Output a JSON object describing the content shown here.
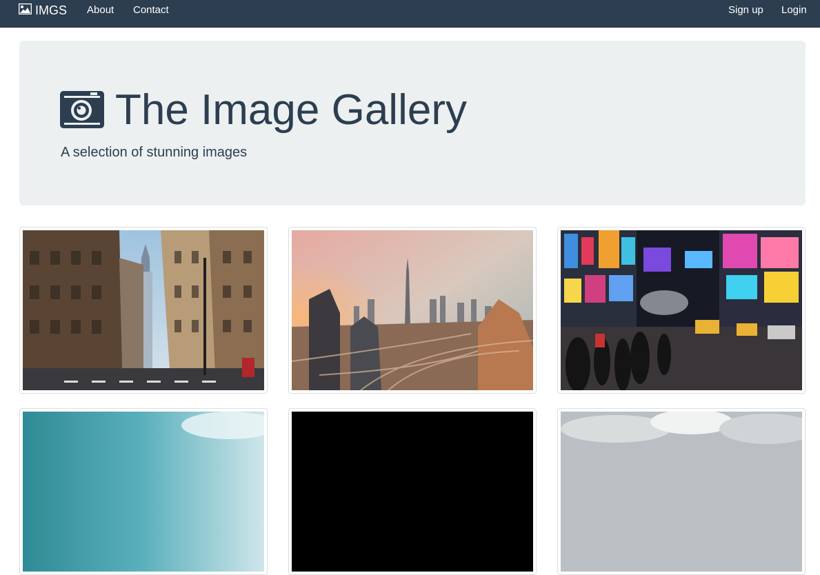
{
  "navbar": {
    "brand": {
      "icon": "image-icon",
      "label": "IMGS"
    },
    "left_links": [
      {
        "label": "About"
      },
      {
        "label": "Contact"
      }
    ],
    "right_links": [
      {
        "label": "Sign up"
      },
      {
        "label": "Login"
      }
    ]
  },
  "jumbotron": {
    "icon": "camera-icon",
    "title": "The Image Gallery",
    "subtitle": "A selection of stunning images"
  },
  "gallery": {
    "images": [
      {
        "name": "city-street-skyscraper-photo",
        "row": 1,
        "col": 1
      },
      {
        "name": "desert-city-highways-sunset-photo",
        "row": 1,
        "col": 2
      },
      {
        "name": "times-square-night-photo",
        "row": 1,
        "col": 3
      },
      {
        "name": "sky-clouds-photo",
        "row": 2,
        "col": 1
      },
      {
        "name": "dark-photo",
        "row": 2,
        "col": 2
      },
      {
        "name": "clouds-landscape-photo",
        "row": 2,
        "col": 3
      }
    ]
  },
  "colors": {
    "navbar_bg": "#2c3e50",
    "jumbotron_bg": "#ecf0f1",
    "text_primary": "#2c3e50"
  }
}
